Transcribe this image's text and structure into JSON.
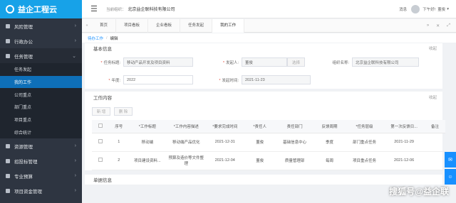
{
  "app": {
    "logo_text": "益企工程云"
  },
  "sidebar": {
    "items": [
      {
        "label": "风险管理",
        "icon": "shield-icon"
      },
      {
        "label": "行政办公",
        "icon": "folder-icon"
      },
      {
        "label": "任务管理",
        "icon": "task-icon",
        "expanded": true,
        "children": [
          "任务发起",
          "我的工作",
          "公司重点",
          "部门重点",
          "项目重点",
          "综合统计"
        ],
        "active_child": "我的工作"
      },
      {
        "label": "资源管理",
        "icon": "database-icon"
      },
      {
        "label": "招投标管理",
        "icon": "bid-icon"
      },
      {
        "label": "专业预算",
        "icon": "calculator-icon"
      },
      {
        "label": "项目资金管理",
        "icon": "money-icon"
      }
    ]
  },
  "topbar": {
    "org_label": "当前组织：",
    "org_name": "北京益企联科技有限公司",
    "messages": "消息",
    "greeting": "下午好!",
    "username": "董俊"
  },
  "tabs": [
    "首页",
    "项目看板",
    "企业看板",
    "任务发起",
    "我的工作",
    "编辑"
  ],
  "active_tab": "我的工作",
  "breadcrumb": {
    "parent": "待办工作",
    "current": "编辑"
  },
  "basic_info": {
    "title": "基本信息",
    "collapse": "收起",
    "task_title_label": "任务标题:",
    "task_title_value": "移动产品开发及项目资料",
    "sponsor_label": "发起人:",
    "sponsor_value": "董俊",
    "select_button": "选择",
    "org_name_label": "组织名称:",
    "org_name_value": "北京益企联科技有限公司",
    "year_label": "年度:",
    "year_value": "2022",
    "start_time_label": "发起时间:",
    "start_time_value": "2021-11-23"
  },
  "work_content": {
    "title": "工作内容",
    "collapse": "收起",
    "add_button": "新 增",
    "delete_button": "删 除",
    "columns": [
      "",
      "序号",
      "*工作标题",
      "*工作内容描述",
      "*要求完成时间",
      "*责任人",
      "责任部门",
      "反馈周期",
      "*任务层级",
      "第一次反馈日...",
      "备注"
    ],
    "rows": [
      {
        "no": "1",
        "title": "移动端",
        "desc": "移动端产品优化",
        "due": "2021-12-31",
        "owner": "董俊",
        "dept": "基础信息中心",
        "cycle": "季度",
        "level": "部门重点任务",
        "first": "2021-11-29",
        "note": ""
      },
      {
        "no": "2",
        "title": "项目建设资料...",
        "desc": "预算及造价等文件整理",
        "due": "2021-12-04",
        "owner": "董俊",
        "dept": "质量管理部",
        "cycle": "每周",
        "level": "项目重点任务",
        "first": "2021-12-06",
        "note": ""
      }
    ]
  },
  "signoff": {
    "title": "单据信息"
  },
  "watermark": "搜狐号@益企联",
  "colors": {
    "brand": "#17a2e8",
    "sidebar_bg": "#2e3541",
    "active": "#0e6fb8",
    "float": "#1890ff"
  }
}
